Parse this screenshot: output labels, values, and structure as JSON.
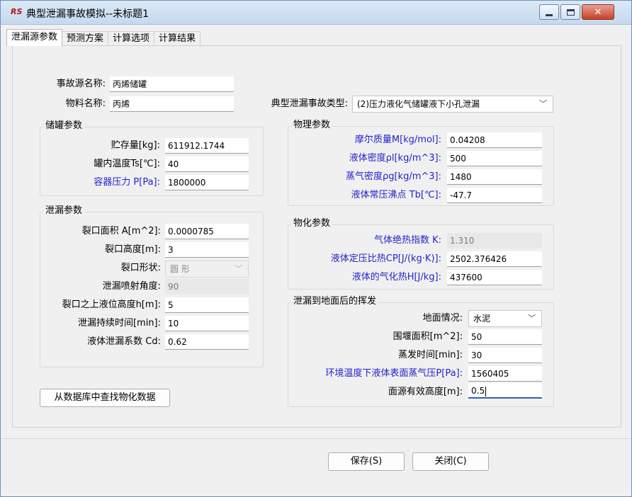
{
  "window": {
    "title": "典型泄漏事故模拟--未标题1",
    "icon": "app-logo-icon"
  },
  "tabs": [
    "泄漏源参数",
    "预测方案",
    "计算选项",
    "计算结果"
  ],
  "source": {
    "name_label": "事故源名称:",
    "name_value": "丙烯储罐",
    "material_label": "物料名称:",
    "material_value": "丙烯",
    "accident_type_label": "典型泄漏事故类型:",
    "accident_type_value": "(2)压力液化气储罐液下小孔泄漏"
  },
  "tank": {
    "title": "储罐参数",
    "storage_label": "贮存量[kg]:",
    "storage_value": "611912.1744",
    "temp_label": "罐内温度Ts[℃]:",
    "temp_value": "40",
    "pressure_label": "容器压力 P[Pa]:",
    "pressure_value": "1800000"
  },
  "leak": {
    "title": "泄漏参数",
    "area_label": "裂口面积 A[m^2]:",
    "area_value": "0.0000785",
    "height_label": "裂口高度[m]:",
    "height_value": "3",
    "shape_label": "裂口形状:",
    "shape_value": "圆  形",
    "angle_label": "泄漏喷射角度:",
    "angle_value": "90",
    "level_label": "裂口之上液位高度h[m]:",
    "level_value": "5",
    "duration_label": "泄漏持续时间[min]:",
    "duration_value": "10",
    "cd_label": "液体泄漏系数  Cd:",
    "cd_value": "0.62"
  },
  "physical": {
    "title": "物理参数",
    "molar_label": "摩尔质量M[kg/mol]:",
    "molar_value": "0.04208",
    "liquid_density_label": "液体密度ρl[kg/m^3]:",
    "liquid_density_value": "500",
    "vapor_density_label": "蒸气密度ρg[kg/m^3]:",
    "vapor_density_value": "1480",
    "boiling_label": "液体常压沸点 Tb[℃]:",
    "boiling_value": "-47.7"
  },
  "chemical": {
    "title": "物化参数",
    "adiabatic_label": "气体绝热指数 K:",
    "adiabatic_value": "1.310",
    "cp_label": "液体定压比热CP[J/(kg·K)]:",
    "cp_value": "2502.376426",
    "heat_label": "液体的气化热H[J/kg]:",
    "heat_value": "437600"
  },
  "evap": {
    "title": "泄漏到地面后的挥发",
    "ground_label": "地面情况:",
    "ground_value": "水泥",
    "bund_label": "围堰面积[m^2]:",
    "bund_value": "50",
    "time_label": "蒸发时间[min]:",
    "time_value": "30",
    "vp_label": "环境温度下液体表面蒸气压P[Pa]:",
    "vp_value": "1560405",
    "height_label": "面源有效高度[m]:",
    "height_value": "0.5"
  },
  "buttons": {
    "lookup": "从数据库中查找物化数据",
    "save": "保存(S)",
    "close": "关闭(C)"
  },
  "colors": {
    "blue_label": "#2222cc",
    "focus_underline": "#2a60c0",
    "close_button": "#c7402a"
  }
}
